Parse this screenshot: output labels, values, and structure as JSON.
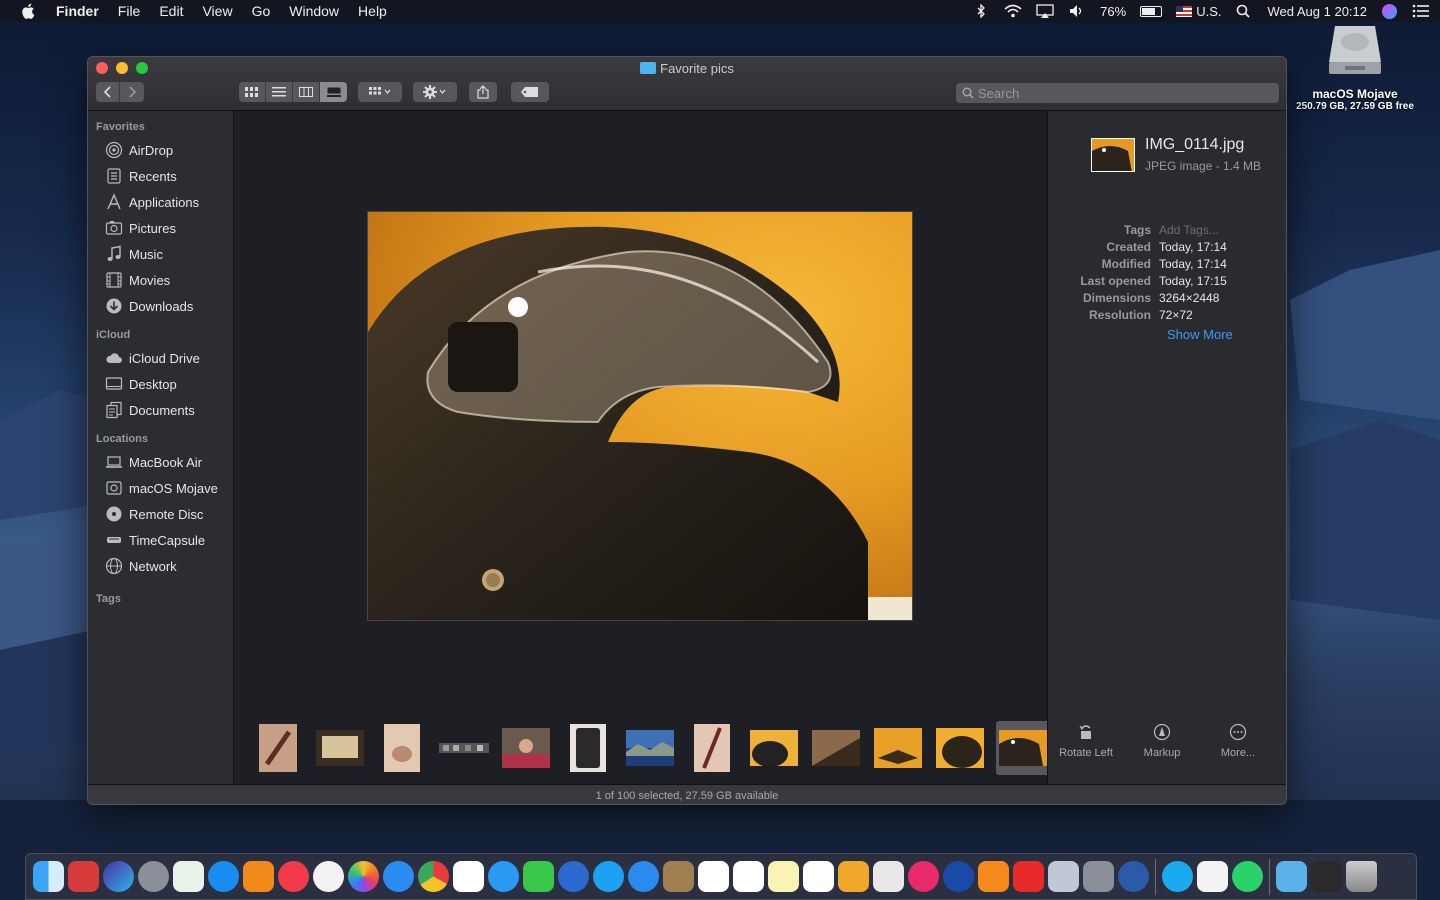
{
  "menubar": {
    "app": "Finder",
    "items": [
      "File",
      "Edit",
      "View",
      "Go",
      "Window",
      "Help"
    ],
    "battery": "76%",
    "battery_level": 0.76,
    "input_source": "U.S.",
    "clock": "Wed Aug 1  20:12"
  },
  "desktop_icon": {
    "name": "macOS Mojave",
    "sub": "250.79 GB, 27.59 GB free"
  },
  "window": {
    "title": "Favorite pics",
    "search_placeholder": "Search"
  },
  "sidebar": {
    "sections": [
      {
        "header": "Favorites",
        "items": [
          {
            "label": "AirDrop",
            "icon": "airdrop-icon"
          },
          {
            "label": "Recents",
            "icon": "recents-icon"
          },
          {
            "label": "Applications",
            "icon": "applications-icon"
          },
          {
            "label": "Pictures",
            "icon": "pictures-icon"
          },
          {
            "label": "Music",
            "icon": "music-icon"
          },
          {
            "label": "Movies",
            "icon": "movies-icon"
          },
          {
            "label": "Downloads",
            "icon": "downloads-icon"
          }
        ]
      },
      {
        "header": "iCloud",
        "items": [
          {
            "label": "iCloud Drive",
            "icon": "cloud-icon"
          },
          {
            "label": "Desktop",
            "icon": "desktop-icon"
          },
          {
            "label": "Documents",
            "icon": "documents-icon"
          }
        ]
      },
      {
        "header": "Locations",
        "items": [
          {
            "label": "MacBook Air",
            "icon": "laptop-icon"
          },
          {
            "label": "macOS Mojave",
            "icon": "disk-icon"
          },
          {
            "label": "Remote Disc",
            "icon": "disc-icon"
          },
          {
            "label": "TimeCapsule",
            "icon": "timecapsule-icon"
          },
          {
            "label": "Network",
            "icon": "network-icon"
          }
        ]
      },
      {
        "header": "Tags",
        "items": []
      }
    ]
  },
  "info": {
    "filename": "IMG_0114.jpg",
    "filetype": "JPEG image - 1.4 MB",
    "meta": [
      {
        "key": "Tags",
        "value": "Add Tags...",
        "placeholder": true
      },
      {
        "key": "Created",
        "value": "Today, 17:14"
      },
      {
        "key": "Modified",
        "value": "Today, 17:14"
      },
      {
        "key": "Last opened",
        "value": "Today, 17:15"
      },
      {
        "key": "Dimensions",
        "value": "3264×2448"
      },
      {
        "key": "Resolution",
        "value": "72×72"
      }
    ],
    "show_more": "Show More",
    "actions": [
      {
        "label": "Rotate Left",
        "icon": "rotate-left-icon"
      },
      {
        "label": "Markup",
        "icon": "markup-icon"
      },
      {
        "label": "More...",
        "icon": "more-icon"
      }
    ]
  },
  "status": "1 of 100 selected, 27.59 GB available",
  "colors": {
    "accent": "#3d9cf5",
    "window_bg": "#1e1f24",
    "sidebar_bg": "#2c2d31"
  }
}
